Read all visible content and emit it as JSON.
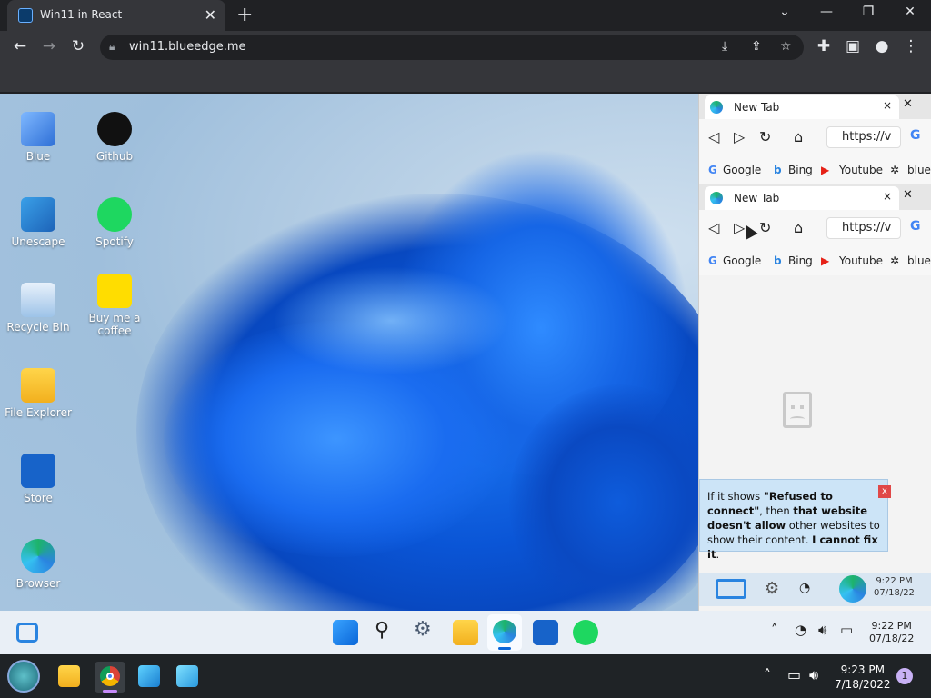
{
  "browser": {
    "tab_title": "Win11 in React",
    "tab_close": "✕",
    "new_tab": "+",
    "url": "win11.blueedge.me",
    "window_controls": {
      "minimize": "—",
      "restore": "❐",
      "close": "✕",
      "tabsearch": "⌄"
    }
  },
  "desktop": {
    "icons": [
      {
        "label": "Blue"
      },
      {
        "label": "Github"
      },
      {
        "label": "Unescape"
      },
      {
        "label": "Spotify"
      },
      {
        "label": "Recycle Bin"
      },
      {
        "label": "Buy me a coffee"
      },
      {
        "label": "File Explorer"
      },
      {
        "label": "Store"
      },
      {
        "label": "Browser"
      }
    ]
  },
  "edge": {
    "tabs": [
      {
        "title": "New Tab",
        "close": "×",
        "window_close": "✕"
      },
      {
        "title": "New Tab",
        "close": "×",
        "window_close": "✕"
      }
    ],
    "url_text": "https://v",
    "search_glyph": "G",
    "bookmarks": [
      "Google",
      "Bing",
      "Youtube",
      "bluee"
    ],
    "tooltip": {
      "p1": "If it shows ",
      "b1": "\"Refused to connect\"",
      "p2": ", then ",
      "b2": "that website doesn't allow",
      "p3": " other websites to show their content. ",
      "b3": "I cannot fix it",
      "p4": ".",
      "close": "x"
    },
    "mini_clock": {
      "time": "9:22 PM",
      "date": "07/18/22"
    }
  },
  "win_taskbar": {
    "clock": {
      "time": "9:22 PM",
      "date": "07/18/22"
    }
  },
  "host_taskbar": {
    "clock": {
      "time": "9:23 PM",
      "date": "7/18/2022"
    },
    "notification_count": "1"
  },
  "colors": {
    "accent": "#0a66d8",
    "edge_blue": "#2a84e0",
    "spotify": "#1ed760"
  }
}
